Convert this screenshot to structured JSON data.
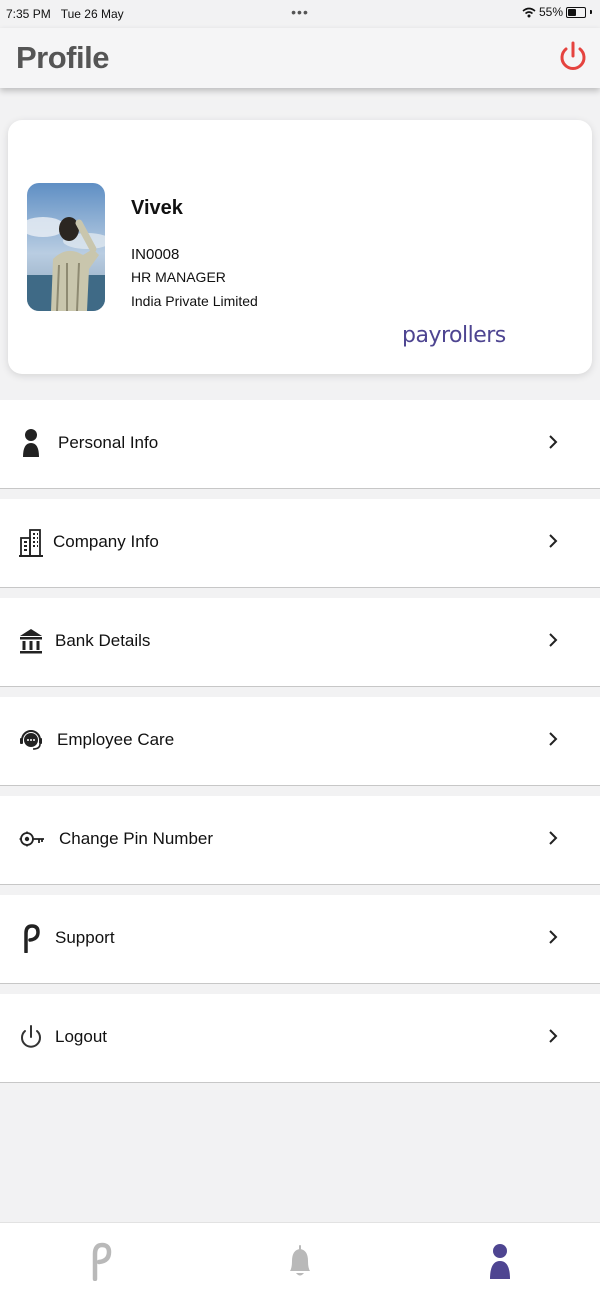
{
  "status_bar": {
    "time": "7:35 PM",
    "date": "Tue 26 May",
    "battery": "55%",
    "battery_level": 0.55
  },
  "header": {
    "title": "Profile",
    "power_icon": "power-icon",
    "power_color": "#e5433f"
  },
  "profile": {
    "name": "Vivek",
    "employee_id": "IN0008",
    "designation": "HR MANAGER",
    "company": "India Private Limited",
    "brand": "payrollers",
    "brand_color": "#4e4591"
  },
  "menu": [
    {
      "label": "Personal Info",
      "icon": "person-icon"
    },
    {
      "label": "Company Info",
      "icon": "building-icon"
    },
    {
      "label": "Bank Details",
      "icon": "bank-icon"
    },
    {
      "label": "Employee Care",
      "icon": "headset-icon"
    },
    {
      "label": "Change Pin Number",
      "icon": "key-icon"
    },
    {
      "label": "Support",
      "icon": "support-p-icon"
    },
    {
      "label": "Logout",
      "icon": "power-icon"
    }
  ],
  "bottom_nav": [
    {
      "icon": "home-p-icon",
      "active": false
    },
    {
      "icon": "bell-icon",
      "active": false
    },
    {
      "icon": "profile-icon",
      "active": true
    }
  ],
  "colors": {
    "accent": "#4e4591",
    "inactive": "#b9b9b9",
    "danger": "#e5433f"
  }
}
